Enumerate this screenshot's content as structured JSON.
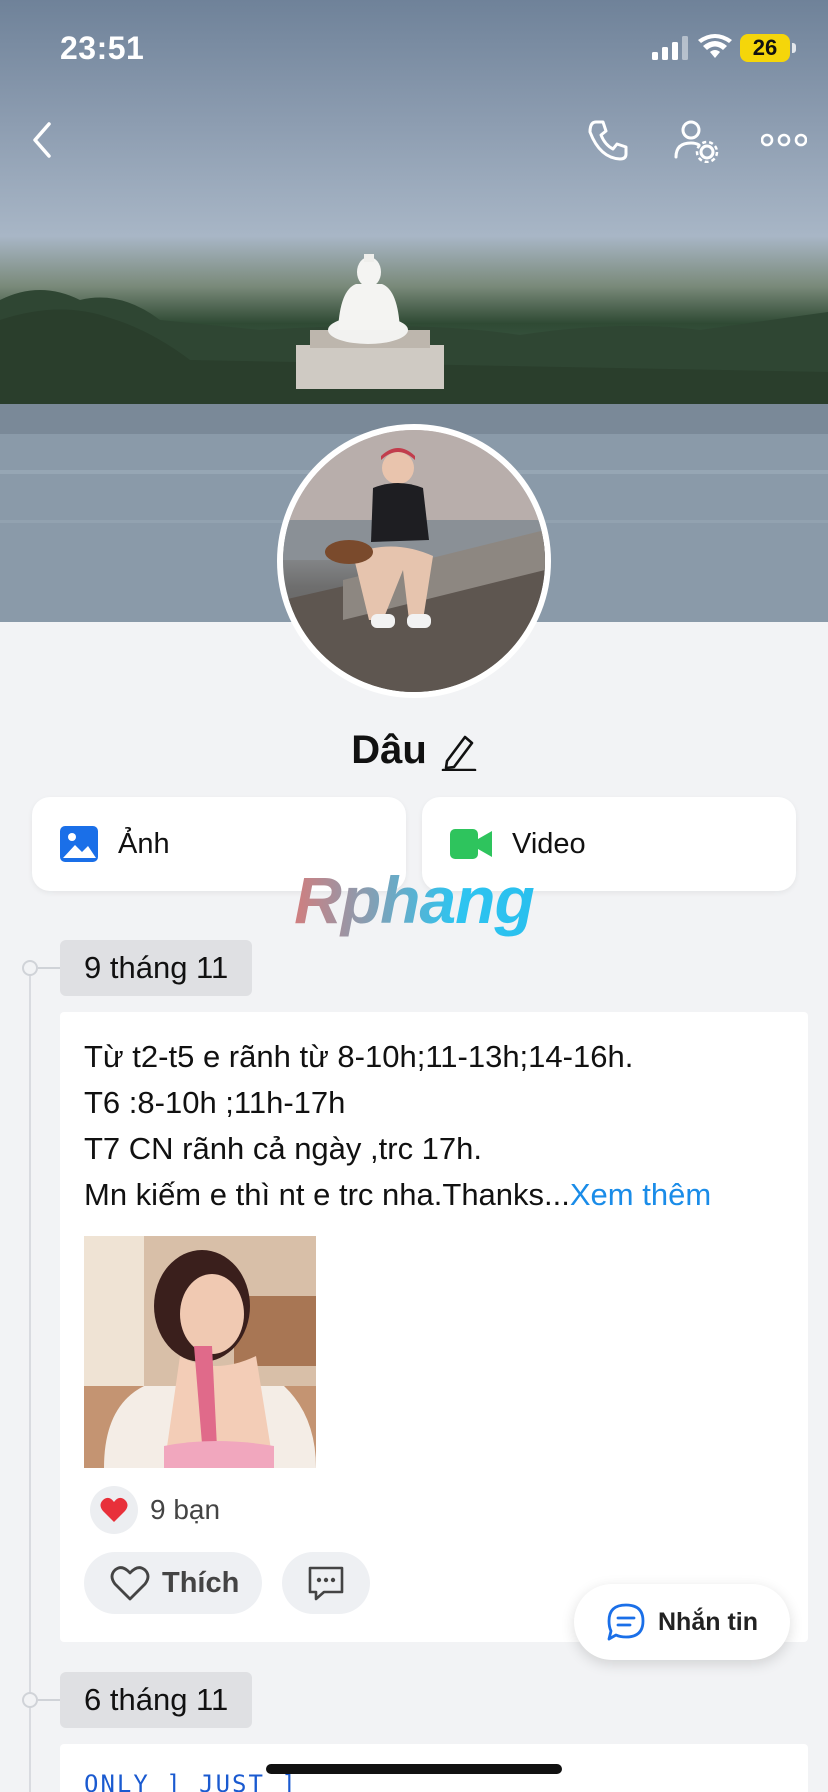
{
  "status_bar": {
    "time": "23:51",
    "battery": "26"
  },
  "profile": {
    "name": "Dâu"
  },
  "media": {
    "photos_label": "Ảnh",
    "videos_label": "Video"
  },
  "watermark": "Rphang",
  "posts": [
    {
      "date": "9 tháng 11",
      "lines": [
        "Từ t2-t5 e rãnh từ 8-10h;11-13h;14-16h.",
        "T6 :8-10h ;11h-17h",
        "T7 CN rãnh cả ngày ,trc 17h.",
        "Mn kiếm e thì nt e trc nha.Thanks..."
      ],
      "see_more": "Xem thêm",
      "reaction_count": "9 bạn",
      "like_label": "Thích"
    },
    {
      "date": "6 tháng 11",
      "preview_text": "ONLY ] JUST ]"
    }
  ],
  "message_button": "Nhắn tin",
  "colors": {
    "accent": "#1a8ce8",
    "video_green": "#2ec45d",
    "heart": "#e8303a"
  }
}
